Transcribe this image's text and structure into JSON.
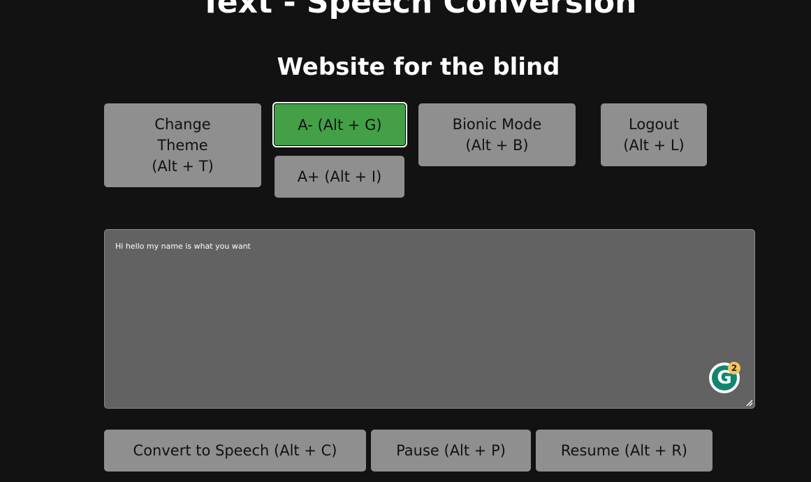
{
  "header": {
    "title": "Text - Speech Conversion",
    "subtitle": "Website for the blind"
  },
  "controls": {
    "theme_line1": "Change",
    "theme_line2": "Theme",
    "theme_line3": "(Alt + T)",
    "font_decrease": "A- (Alt + G)",
    "font_increase": "A+ (Alt + I)",
    "bionic_line1": "Bionic Mode",
    "bionic_line2": "(Alt + B)",
    "logout_line1": "Logout",
    "logout_line2": "(Alt + L)"
  },
  "editor": {
    "value": "Hi hello my name is what you want",
    "grammarly_count": "2",
    "grammarly_icon": "grammarly-icon"
  },
  "actions": {
    "convert": "Convert to Speech (Alt + C)",
    "pause": "Pause (Alt + P)",
    "resume": "Resume (Alt + R)"
  },
  "colors": {
    "background": "#121212",
    "button": "#8f8f8f",
    "active_button": "#43a047",
    "textarea": "#626262",
    "grammarly": "#11866f"
  }
}
